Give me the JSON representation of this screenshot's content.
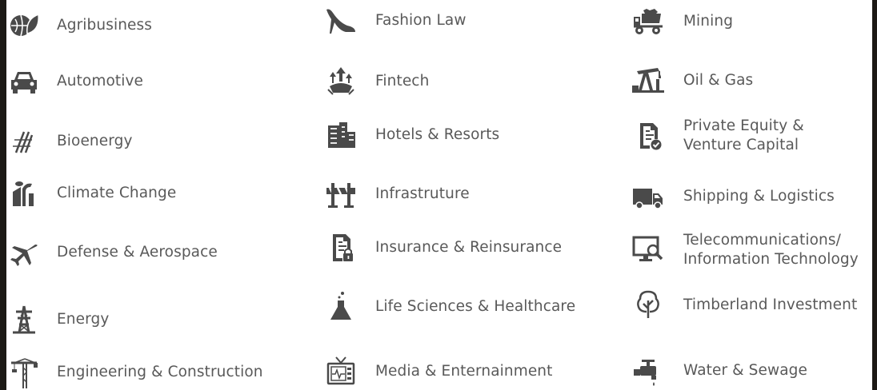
{
  "industries": {
    "col1": [
      {
        "label": "Agribusiness",
        "icon": "leaf-globe-icon"
      },
      {
        "label": "Automotive",
        "icon": "car-icon"
      },
      {
        "label": "Bioenergy",
        "icon": "bioenergy-icon"
      },
      {
        "label": "Climate Change",
        "icon": "factory-icon"
      },
      {
        "label": "Defense & Aerospace",
        "icon": "airplane-icon"
      },
      {
        "label": "Energy",
        "icon": "power-tower-icon"
      },
      {
        "label": "Engineering & Construction",
        "icon": "crane-icon"
      }
    ],
    "col2": [
      {
        "label": "Fashion Law",
        "icon": "high-heel-icon"
      },
      {
        "label": "Fintech",
        "icon": "fintech-icon"
      },
      {
        "label": "Hotels & Resorts",
        "icon": "buildings-icon"
      },
      {
        "label": "Infrastruture",
        "icon": "barrier-icon"
      },
      {
        "label": "Insurance & Reinsurance",
        "icon": "locked-document-icon"
      },
      {
        "label": "Life Sciences & Healthcare",
        "icon": "flask-icon"
      },
      {
        "label": "Media & Enternainment",
        "icon": "tv-icon"
      }
    ],
    "col3": [
      {
        "label": "Mining",
        "icon": "mining-truck-icon"
      },
      {
        "label": "Oil & Gas",
        "icon": "oil-pump-icon"
      },
      {
        "label": "Private Equity &\nVenture Capital",
        "line1": "Private Equity &",
        "line2": "Venture Capital",
        "icon": "approved-document-icon"
      },
      {
        "label": "Shipping & Logistics",
        "icon": "truck-icon"
      },
      {
        "label": "Telecommunications/\nInformation Technology",
        "line1": "Telecommunications/",
        "line2": "Information Technology",
        "icon": "computer-search-icon"
      },
      {
        "label": "Timberland Investment",
        "icon": "tree-icon"
      },
      {
        "label": "Water & Sewage",
        "icon": "water-tap-icon"
      }
    ]
  },
  "colors": {
    "text": "#595959",
    "icon": "#4a4a4a",
    "background": "#ffffff",
    "frame": "#1c1915"
  }
}
